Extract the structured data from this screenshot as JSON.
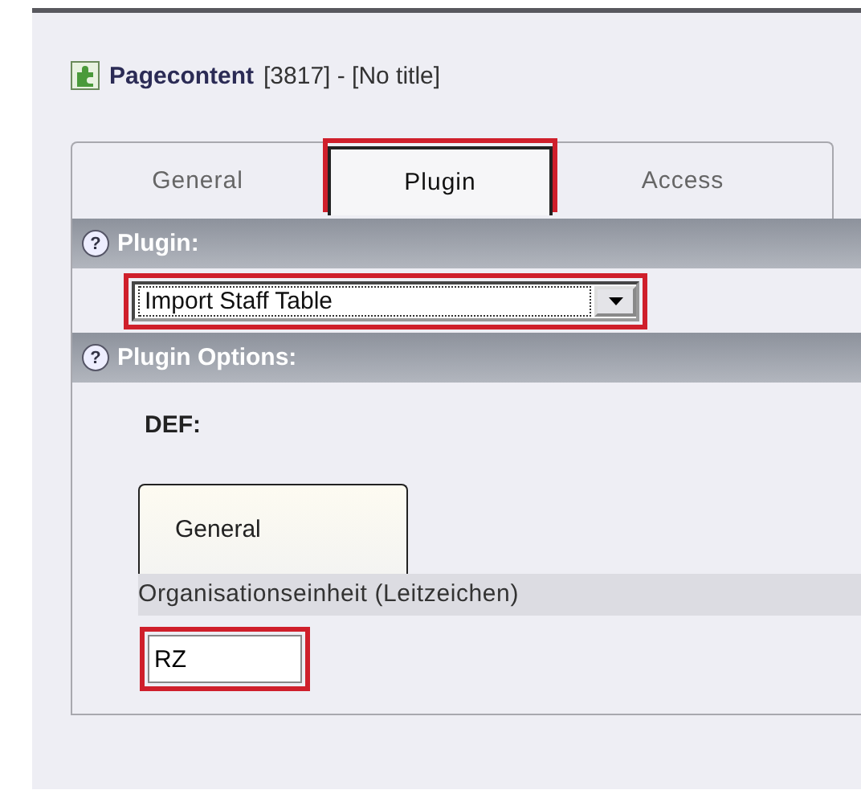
{
  "header": {
    "type_label": "Pagecontent",
    "info": "[3817] - [No title]"
  },
  "tabs": [
    {
      "label": "General",
      "selected": false,
      "highlighted": false
    },
    {
      "label": "Plugin",
      "selected": true,
      "highlighted": true
    },
    {
      "label": "Access",
      "selected": false,
      "highlighted": false
    }
  ],
  "sections": [
    {
      "help_icon": "?",
      "title": "Plugin:"
    },
    {
      "help_icon": "?",
      "title": "Plugin Options:"
    }
  ],
  "plugin_select": {
    "value": "Import Staff Table",
    "highlighted": true
  },
  "flexform": {
    "sheet_label": "DEF:",
    "sheet_tabs": [
      {
        "label": "General",
        "selected": true
      }
    ],
    "field_label": "Organisationseinheit (Leitzeichen)",
    "field_value": "RZ",
    "field_highlighted": true
  }
}
